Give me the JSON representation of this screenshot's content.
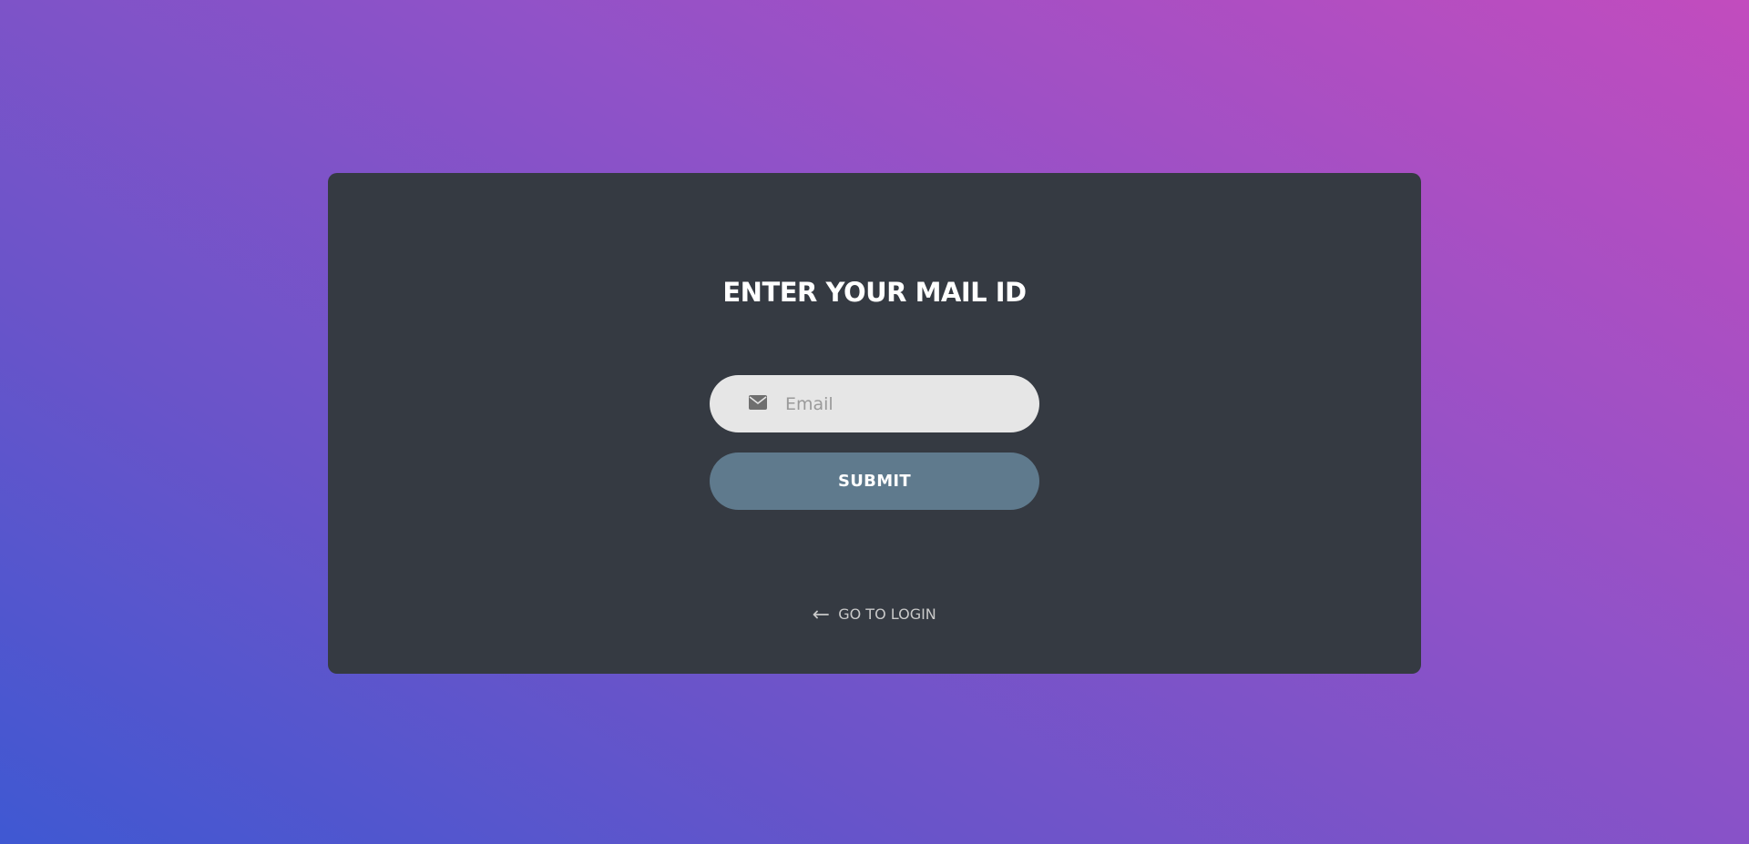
{
  "form": {
    "title": "ENTER YOUR MAIL ID",
    "email_placeholder": "Email",
    "submit_label": "SUBMIT",
    "login_link_label": "GO TO LOGIN"
  },
  "icons": {
    "email": "envelope-icon",
    "back": "long-arrow-left-icon"
  },
  "colors": {
    "card_background": "#353a42",
    "input_background": "#e6e6e6",
    "submit_background": "#5f7a8d",
    "gradient_start": "#3f58d2",
    "gradient_end": "#c24cbe"
  }
}
